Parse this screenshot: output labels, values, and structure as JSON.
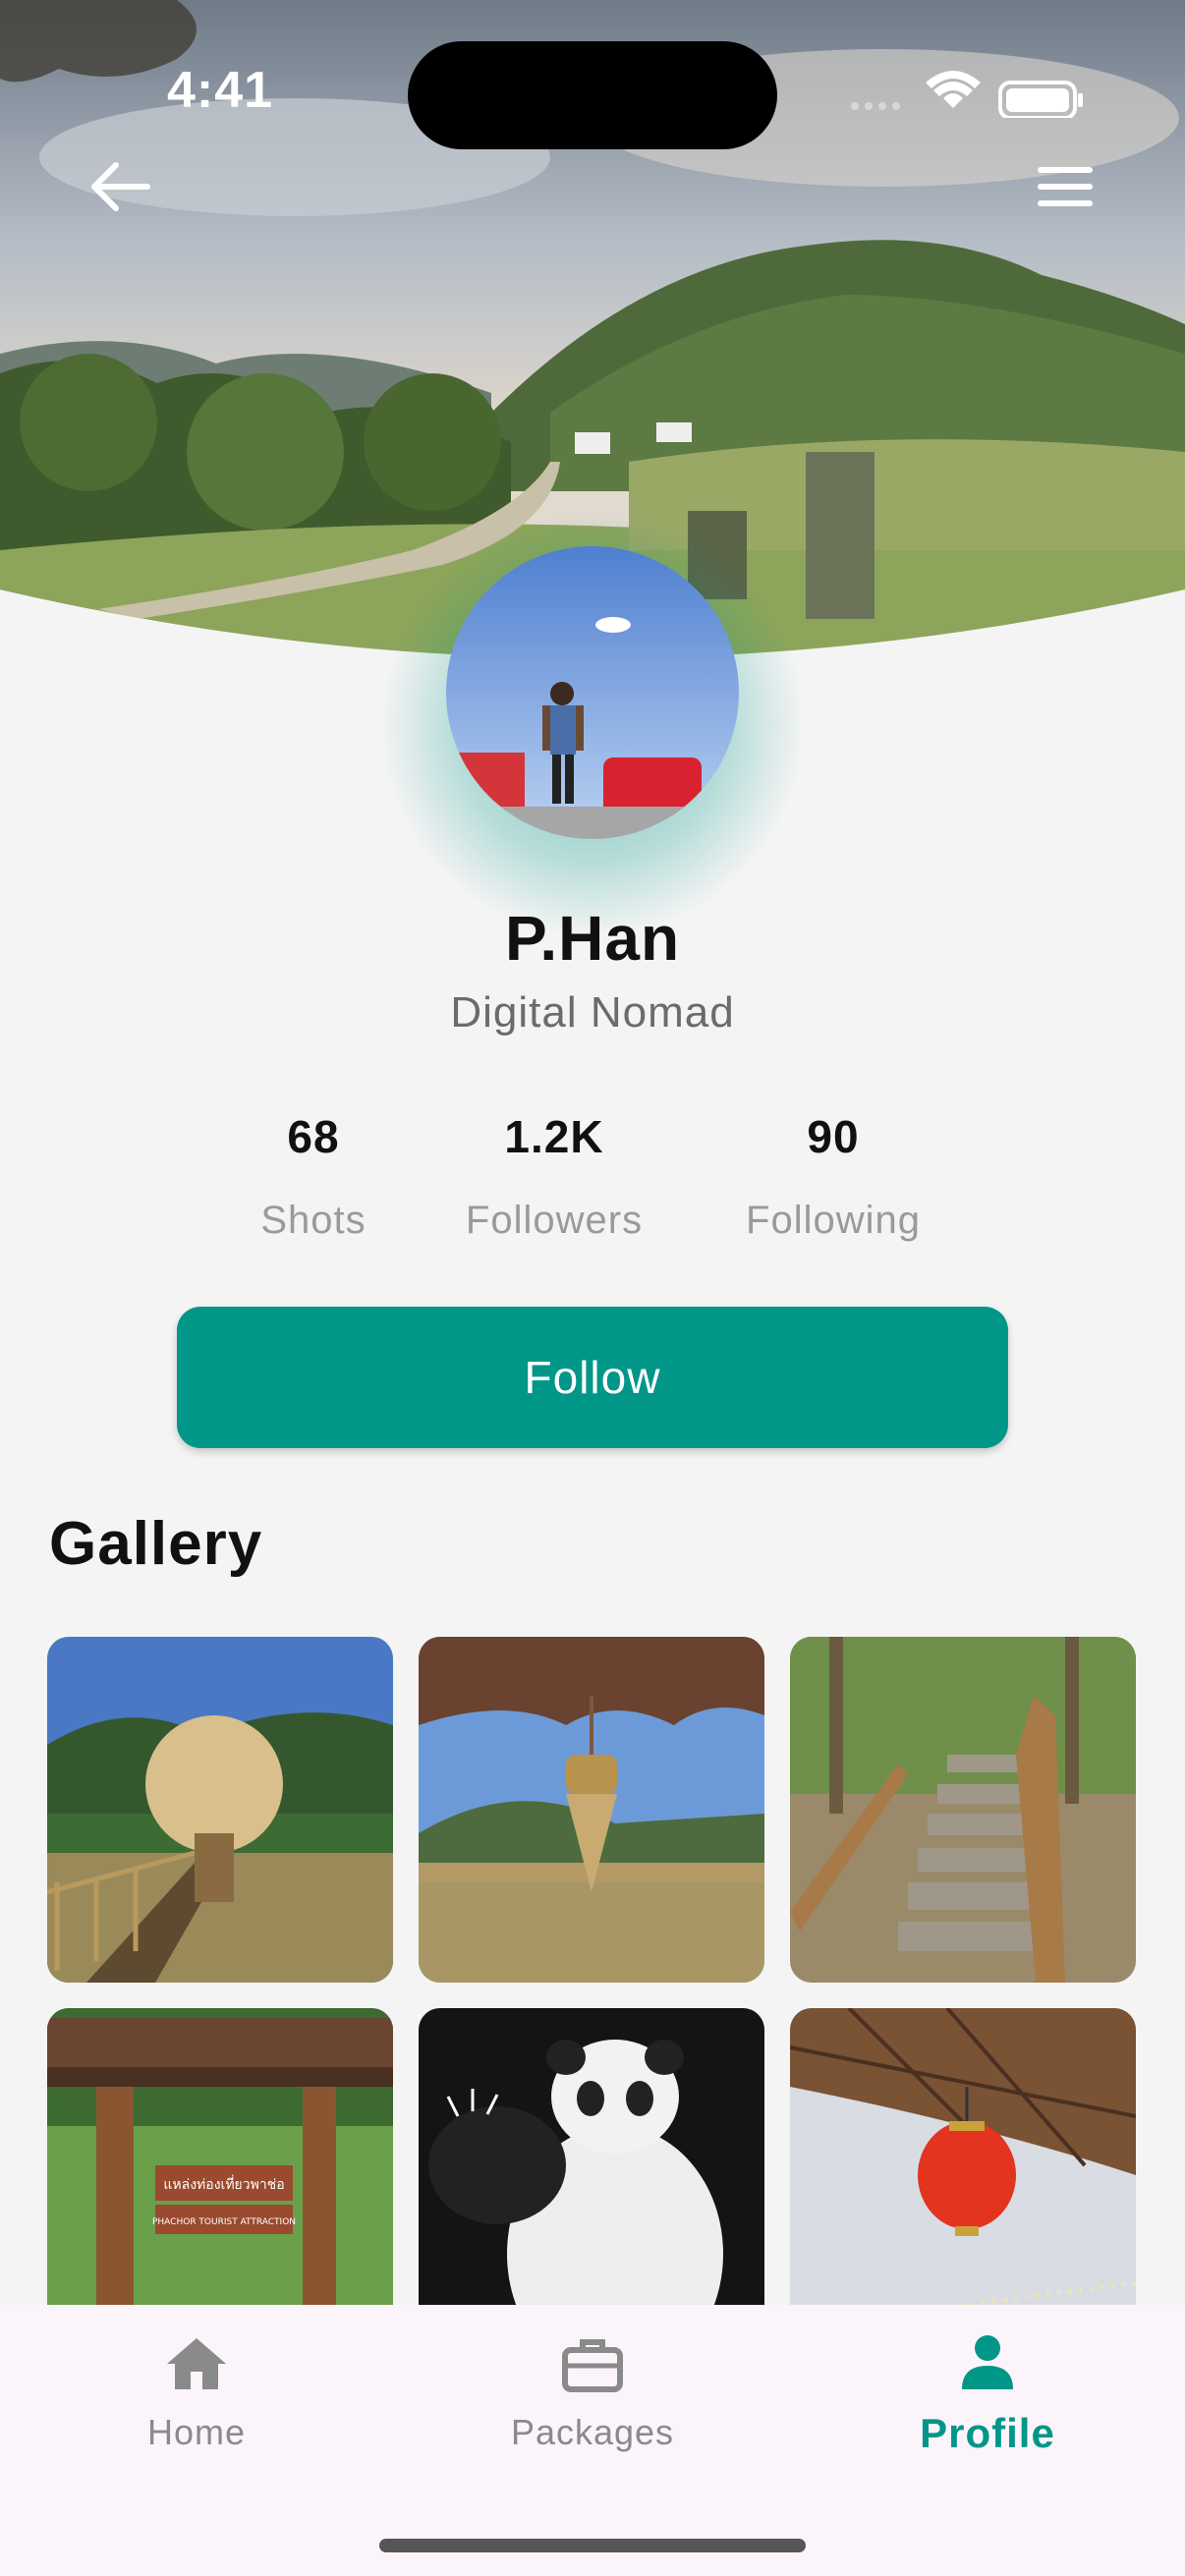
{
  "status_bar": {
    "time": "4:41"
  },
  "profile": {
    "name": "P.Han",
    "role": "Digital Nomad",
    "stats": [
      {
        "value": "68",
        "label": "Shots"
      },
      {
        "value": "1.2K",
        "label": "Followers"
      },
      {
        "value": "90",
        "label": "Following"
      }
    ],
    "follow_label": "Follow"
  },
  "gallery": {
    "title": "Gallery",
    "photos": [
      "dried-flower-bridge",
      "hanging-ornament-field",
      "wooden-stairs",
      "attraction-sign-pavilion",
      "panda-lantern",
      "red-lantern"
    ],
    "sign_text": [
      "แหล่งท่องเที่ยวพาช่อ",
      "PHACHOR TOURIST ATTRACTION"
    ]
  },
  "bottom_nav": {
    "items": [
      {
        "label": "Home",
        "icon": "home-icon"
      },
      {
        "label": "Packages",
        "icon": "briefcase-icon"
      },
      {
        "label": "Profile",
        "icon": "person-icon",
        "active": true
      }
    ]
  },
  "colors": {
    "accent": "#009688",
    "background": "#f4f4f4",
    "nav_background": "#fbf5fb"
  }
}
